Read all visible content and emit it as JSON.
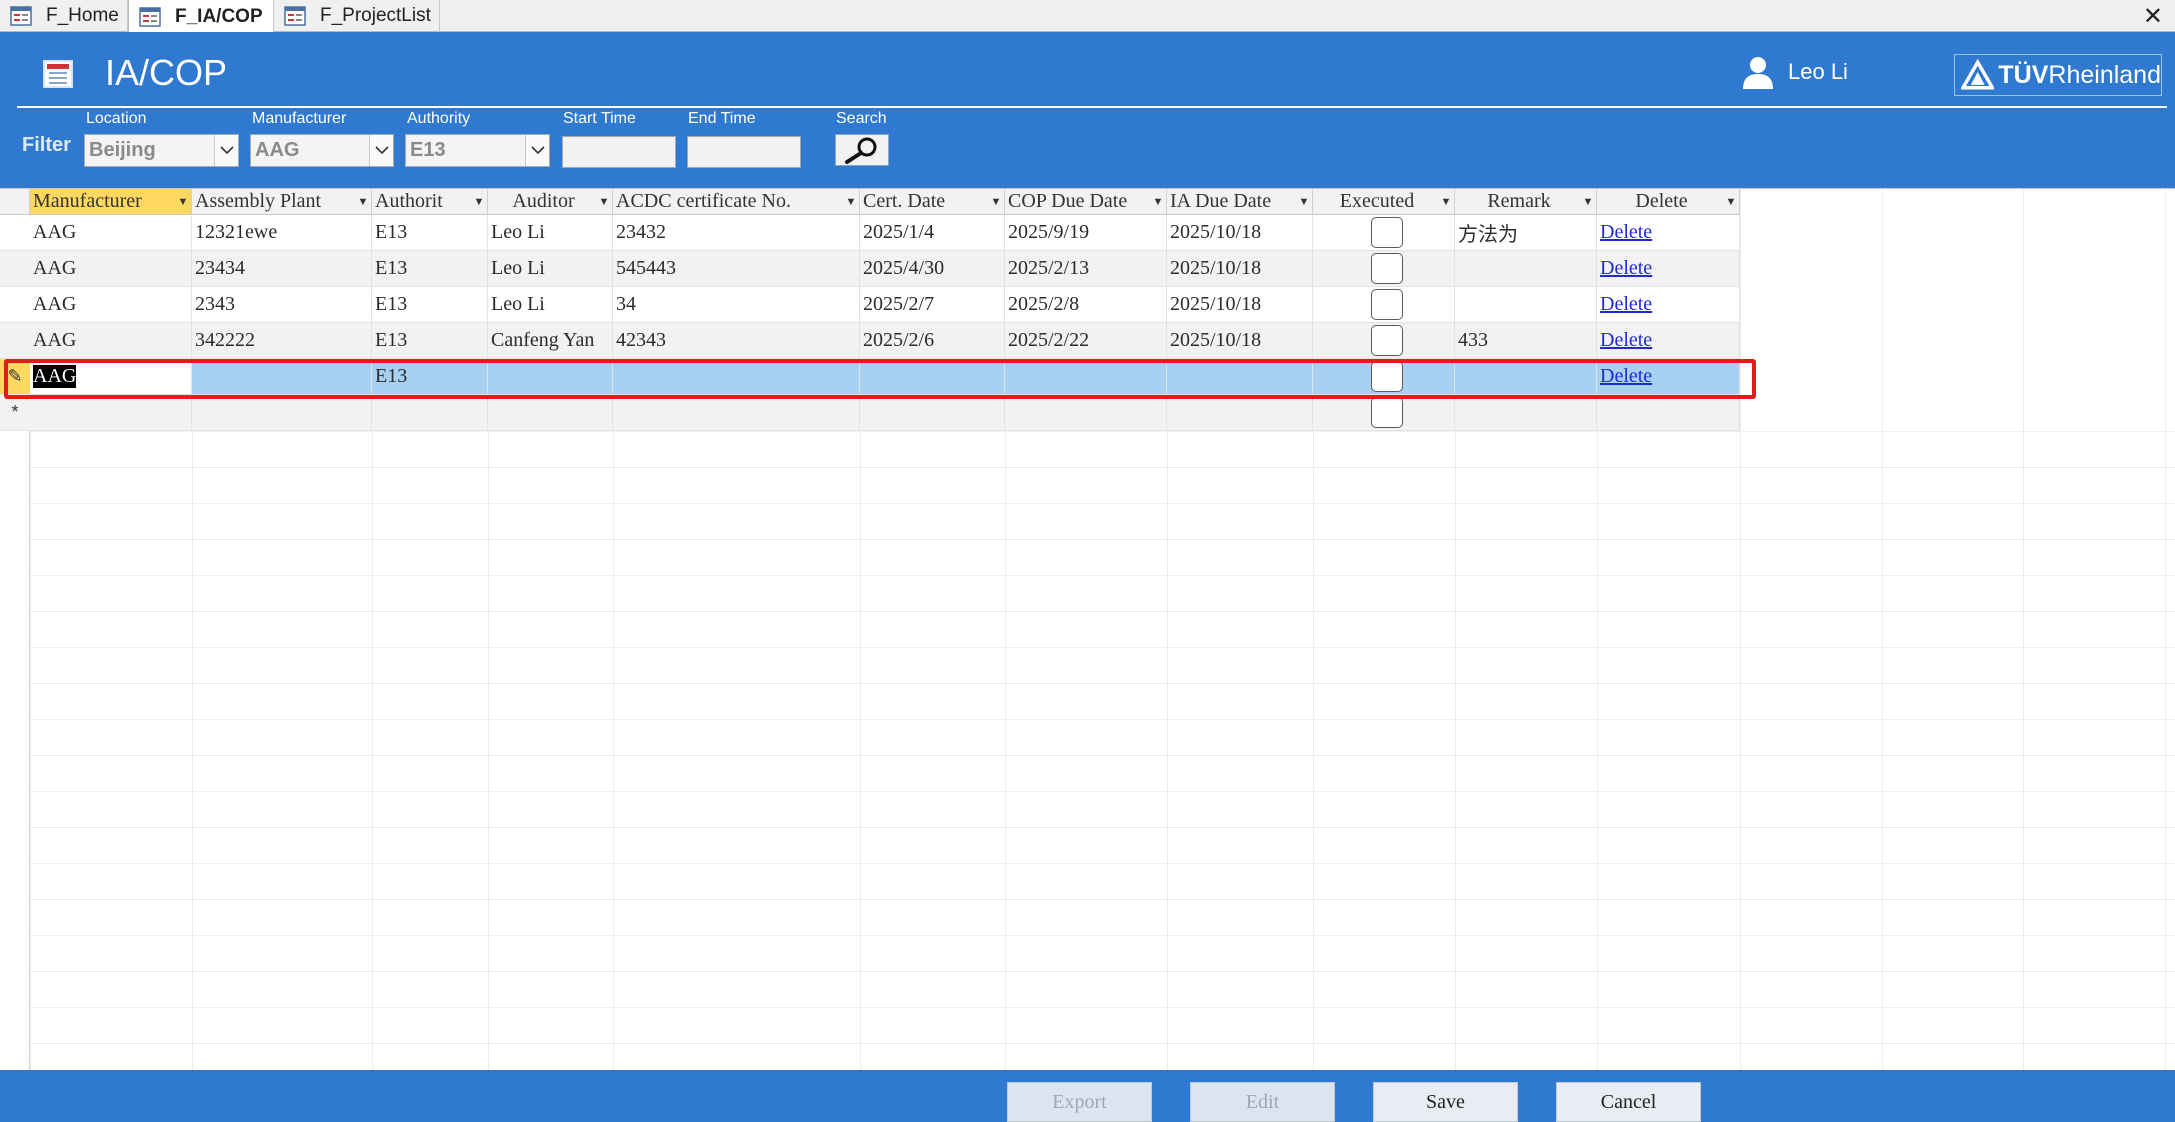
{
  "tabs": [
    {
      "label": "F_Home",
      "active": false
    },
    {
      "label": "F_IA/COP",
      "active": true
    },
    {
      "label": "F_ProjectList",
      "active": false
    }
  ],
  "header": {
    "title": "IA/COP",
    "user": "Leo Li",
    "logo_prefix": "TÜV",
    "logo_suffix": "Rheinland"
  },
  "filter": {
    "label": "Filter",
    "location": {
      "label": "Location",
      "value": "Beijing"
    },
    "manufacturer": {
      "label": "Manufacturer",
      "value": "AAG"
    },
    "authority": {
      "label": "Authority",
      "value": "E13"
    },
    "start_time": {
      "label": "Start Time",
      "value": ""
    },
    "end_time": {
      "label": "End Time",
      "value": ""
    },
    "search": {
      "label": "Search"
    }
  },
  "table": {
    "columns": [
      "Manufacturer",
      "Assembly Plant",
      "Authorit",
      "Auditor",
      "ACDC certificate No.",
      "Cert. Date",
      "COP Due Date",
      "IA Due Date",
      "Executed",
      "Remark",
      "Delete"
    ],
    "rows": [
      {
        "manufacturer": "AAG",
        "plant": "12321ewe",
        "authority": "E13",
        "auditor": "Leo Li",
        "cert_no": "23432",
        "cert_date": "2025/1/4",
        "cop_due": "2025/9/19",
        "cop_overdue": false,
        "ia_due": "2025/10/18",
        "executed": false,
        "remark": "方法为",
        "delete": "Delete"
      },
      {
        "manufacturer": "AAG",
        "plant": "23434",
        "authority": "E13",
        "auditor": "Leo Li",
        "cert_no": "545443",
        "cert_date": "2025/4/30",
        "cop_due": "2025/2/13",
        "cop_overdue": true,
        "ia_due": "2025/10/18",
        "executed": false,
        "remark": "",
        "delete": "Delete"
      },
      {
        "manufacturer": "AAG",
        "plant": "2343",
        "authority": "E13",
        "auditor": "Leo Li",
        "cert_no": "34",
        "cert_date": "2025/2/7",
        "cop_due": "2025/2/8",
        "cop_overdue": true,
        "ia_due": "2025/10/18",
        "executed": false,
        "remark": "",
        "delete": "Delete"
      },
      {
        "manufacturer": "AAG",
        "plant": "342222",
        "authority": "E13",
        "auditor": "Canfeng Yan",
        "cert_no": "42343",
        "cert_date": "2025/2/6",
        "cop_due": "2025/2/22",
        "cop_overdue": true,
        "ia_due": "2025/10/18",
        "executed": false,
        "remark": "433",
        "delete": "Delete"
      }
    ],
    "editing_row": {
      "manufacturer": "AAG",
      "authority": "E13",
      "delete": "Delete"
    },
    "new_row_marker": "*",
    "editing_marker": "✎"
  },
  "footer": {
    "export": "Export",
    "edit": "Edit",
    "save": "Save",
    "cancel": "Cancel"
  },
  "colors": {
    "header_blue": "#2f79d0",
    "overdue_red": "#ec1d23",
    "selected_row": "#a8d0f0",
    "highlight_border": "#e21b1b",
    "sort_header": "#ffd862"
  }
}
